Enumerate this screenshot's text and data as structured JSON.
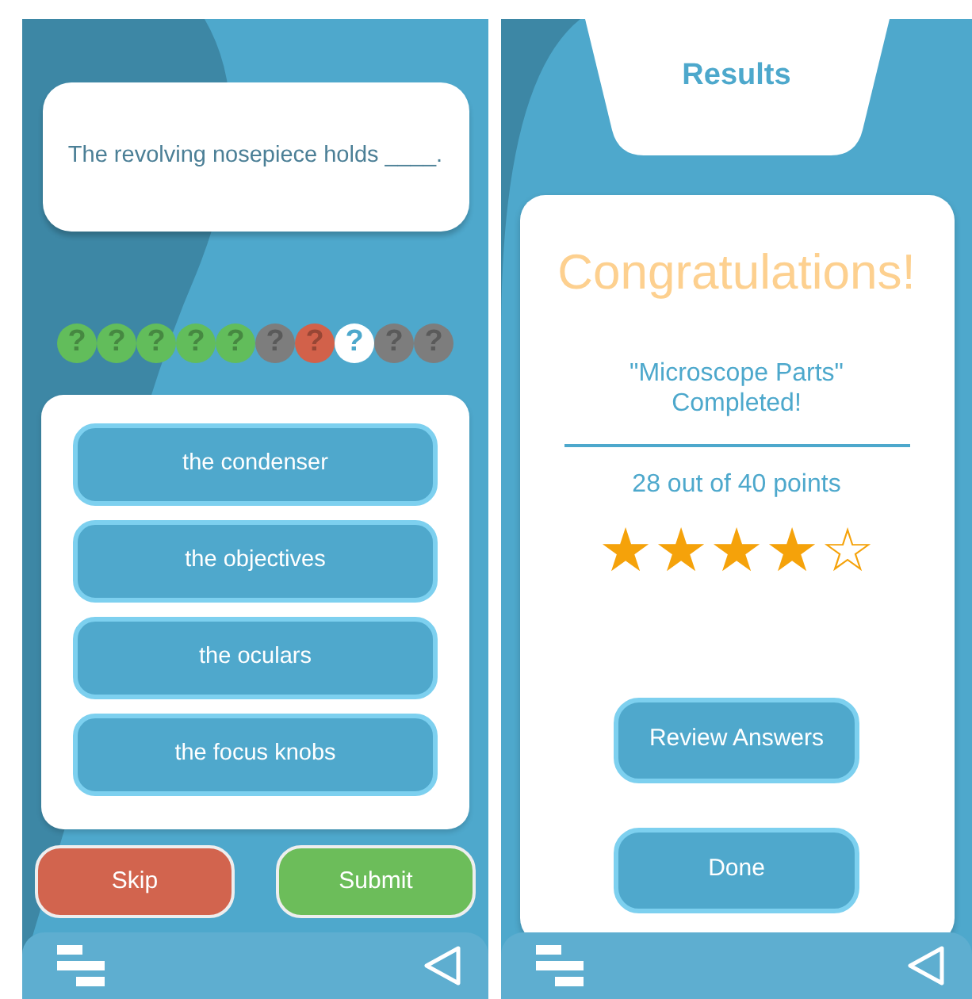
{
  "quiz_screen": {
    "question": "The revolving nosepiece holds ____.",
    "progress": [
      {
        "label": "?",
        "color": "#62bd5b"
      },
      {
        "label": "?",
        "color": "#62bd5b"
      },
      {
        "label": "?",
        "color": "#62bd5b"
      },
      {
        "label": "?",
        "color": "#62bd5b"
      },
      {
        "label": "?",
        "color": "#62bd5b"
      },
      {
        "label": "?",
        "color": "#7d7d7d"
      },
      {
        "label": "?",
        "color": "#d2614a"
      },
      {
        "label": "?",
        "color": "#ffffff"
      },
      {
        "label": "?",
        "color": "#7d7d7d"
      },
      {
        "label": "?",
        "color": "#7d7d7d"
      }
    ],
    "answers": [
      "the condenser",
      "the objectives",
      "the oculars",
      "the focus knobs"
    ],
    "buttons": [
      {
        "label": "Skip",
        "kind": "skip"
      },
      {
        "label": "Submit",
        "kind": "submit"
      }
    ]
  },
  "results_screen": {
    "title": "Results",
    "heading": "Congratulations!",
    "quiz_name": "\"Microscope Parts\" Completed!",
    "score": "28 out of 40 points",
    "stars": 4,
    "buttons": [
      "Review Answers",
      "Done"
    ]
  }
}
